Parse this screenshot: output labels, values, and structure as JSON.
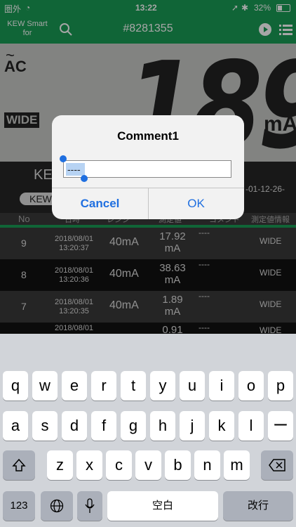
{
  "status_bar": {
    "carrier": "圏外",
    "time": "13:22",
    "battery": "32%"
  },
  "nav": {
    "app_title": "KEW Smart for",
    "device_id": "#8281355"
  },
  "lcd": {
    "mode": "AC",
    "tilde": "~",
    "badge": "WIDE",
    "digits": "189",
    "unit": "mA"
  },
  "header_area": {
    "kew_label": "KE",
    "kew_pill": "KEW",
    "date_fragment": "-01-12-26-"
  },
  "table": {
    "columns": [
      "No",
      "日時",
      "レンジ",
      "測定値",
      "コメント",
      "測定値情報"
    ],
    "rows": [
      {
        "no": "9",
        "date": "2018/08/01",
        "time": "13:20:37",
        "range": "40mA",
        "value": "17.92",
        "unit": "mA",
        "comment": "----",
        "info": "WIDE"
      },
      {
        "no": "8",
        "date": "2018/08/01",
        "time": "13:20:36",
        "range": "40mA",
        "value": "38.63",
        "unit": "mA",
        "comment": "----",
        "info": "WIDE"
      },
      {
        "no": "7",
        "date": "2018/08/01",
        "time": "13:20:35",
        "range": "40mA",
        "value": "1.89",
        "unit": "mA",
        "comment": "----",
        "info": "WIDE"
      },
      {
        "no": "",
        "date": "2018/08/01",
        "time": "",
        "range": "",
        "value": "0.91",
        "unit": "",
        "comment": "----",
        "info": "WIDE"
      }
    ]
  },
  "dialog": {
    "title": "Comment1",
    "input_value": "----",
    "cancel": "Cancel",
    "ok": "OK"
  },
  "keyboard": {
    "row1": [
      "q",
      "w",
      "e",
      "r",
      "t",
      "y",
      "u",
      "i",
      "o",
      "p"
    ],
    "row2": [
      "a",
      "s",
      "d",
      "f",
      "g",
      "h",
      "j",
      "k",
      "l",
      "ー"
    ],
    "row3": [
      "z",
      "x",
      "c",
      "v",
      "b",
      "n",
      "m"
    ],
    "numbers_key": "123",
    "space": "空白",
    "return": "改行"
  }
}
